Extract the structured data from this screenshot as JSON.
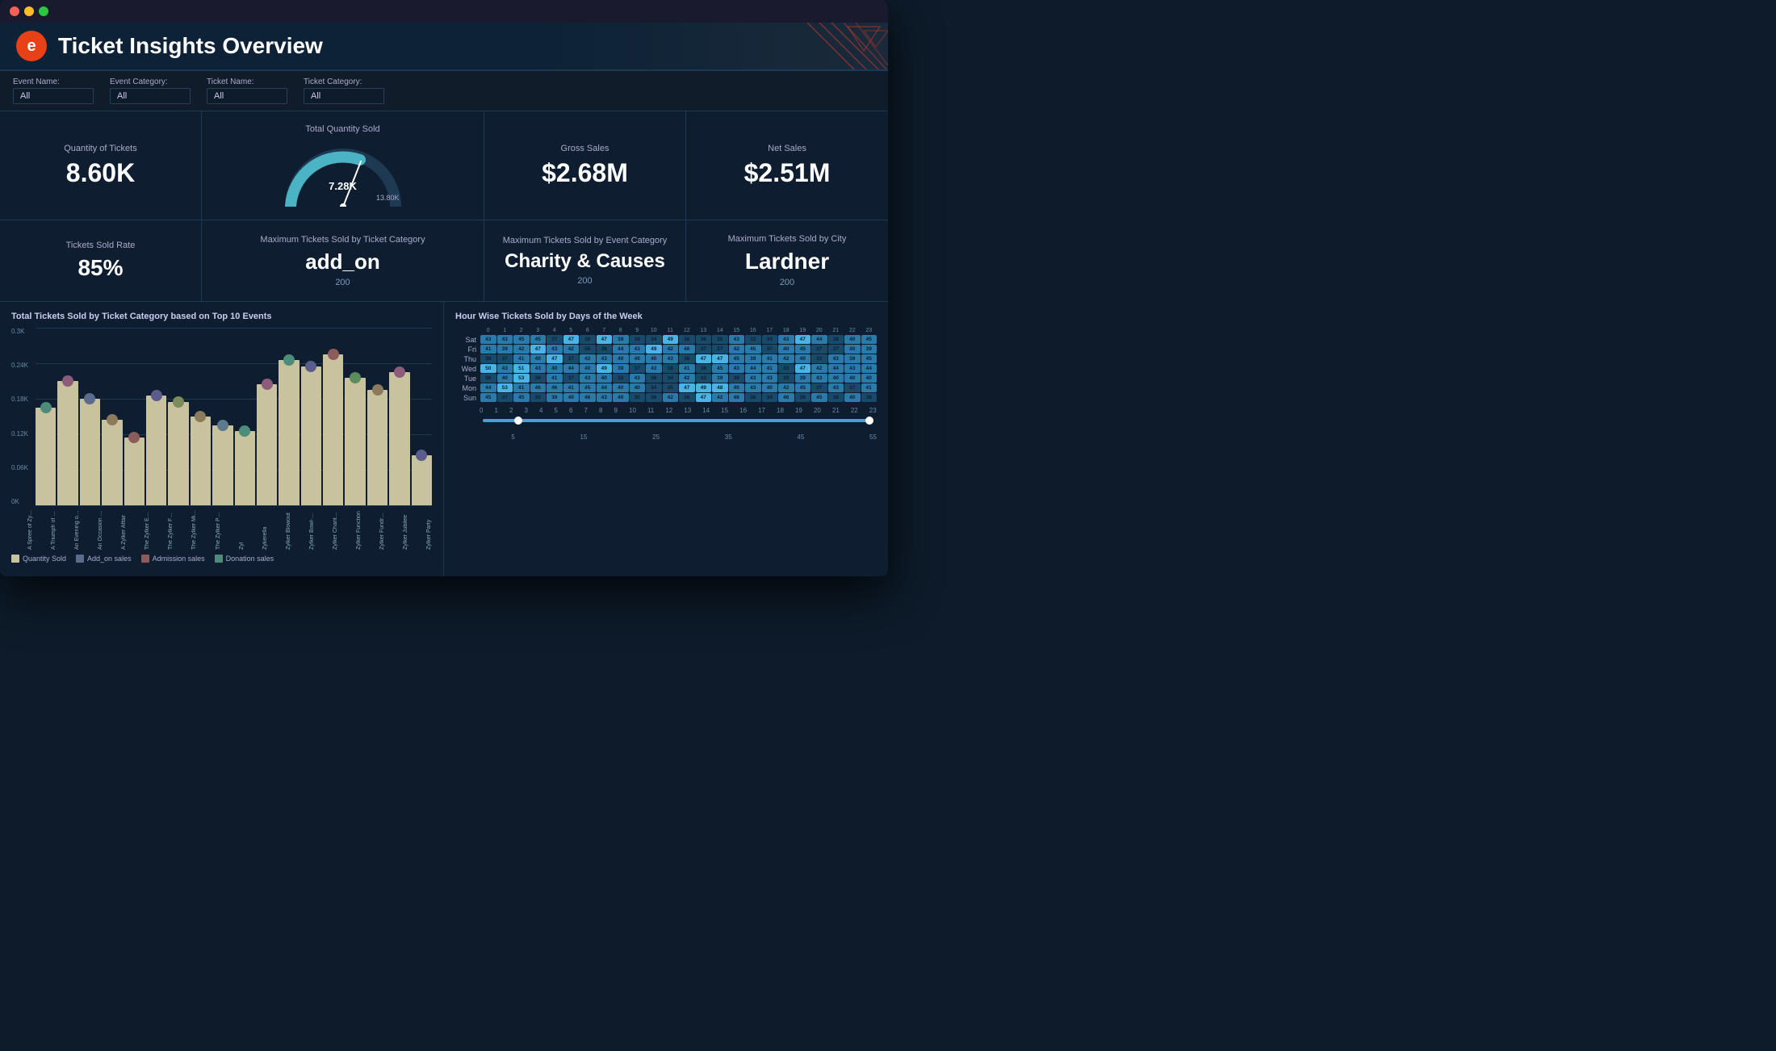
{
  "window": {
    "title": "Ticket Insights Overview"
  },
  "header": {
    "logo_letter": "e",
    "title": "Ticket Insights Overview"
  },
  "filters": [
    {
      "label": "Event Name:",
      "value": "All",
      "options": [
        "All"
      ]
    },
    {
      "label": "Event Category:",
      "value": "All",
      "options": [
        "All"
      ]
    },
    {
      "label": "Ticket Name:",
      "value": "All",
      "options": [
        "All"
      ]
    },
    {
      "label": "Ticket Category:",
      "value": "All",
      "options": [
        "All"
      ]
    }
  ],
  "kpi_row1": {
    "quantity": {
      "label": "Quantity of Tickets",
      "value": "8.60K"
    },
    "gauge": {
      "label": "Total Quantity Sold",
      "center_value": "7.28K",
      "max_value": "13.80K",
      "fill_pct": 53
    },
    "gross_sales": {
      "label": "Gross Sales",
      "value": "$2.68M"
    },
    "net_sales": {
      "label": "Net Sales",
      "value": "$2.51M"
    }
  },
  "kpi_row2": {
    "sold_rate": {
      "label": "Tickets Sold Rate",
      "value": "85%"
    },
    "max_ticket_cat": {
      "label": "Maximum Tickets Sold by Ticket Category",
      "value": "add_on",
      "sub": "200"
    },
    "max_event_cat": {
      "label": "Maximum Tickets Sold by Event Category",
      "value": "Charity & Causes",
      "sub": "200"
    },
    "max_city": {
      "label": "Maximum Tickets Sold by City",
      "value": "Lardner",
      "sub": "200"
    }
  },
  "bar_chart": {
    "title": "Total Tickets Sold by Ticket Category based on Top 10 Events",
    "y_labels": [
      "0.3K",
      "0.24K",
      "0.18K",
      "0.12K",
      "0.06K",
      "0K"
    ],
    "bars": [
      {
        "label": "A Spree of Zylker",
        "height_pct": 55,
        "dot_color": "#4d8c7b"
      },
      {
        "label": "A Triumph of Zylker",
        "height_pct": 70,
        "dot_color": "#8c5c7a"
      },
      {
        "label": "An Evening of Zylker",
        "height_pct": 60,
        "dot_color": "#5c6a8c"
      },
      {
        "label": "An Occasion for Zyl.",
        "height_pct": 48,
        "dot_color": "#8c7a5c"
      },
      {
        "label": "A Zylker Affair",
        "height_pct": 38,
        "dot_color": "#8c5c5c"
      },
      {
        "label": "The Zylker Event or.",
        "height_pct": 62,
        "dot_color": "#5c5c8c"
      },
      {
        "label": "The Zylker Function",
        "height_pct": 58,
        "dot_color": "#7a8c5c"
      },
      {
        "label": "The Zylker Miracle",
        "height_pct": 50,
        "dot_color": "#8c7a5c"
      },
      {
        "label": "The Zylker Perform.",
        "height_pct": 45,
        "dot_color": "#5c7a8c"
      },
      {
        "label": "Zyl",
        "height_pct": 42,
        "dot_color": "#4d8c7b"
      },
      {
        "label": "Zykerella",
        "height_pct": 68,
        "dot_color": "#8c5c7a"
      },
      {
        "label": "Zylker Blowout",
        "height_pct": 82,
        "dot_color": "#4d8c7b"
      },
      {
        "label": "Zylker Bowl-A-Thon",
        "height_pct": 78,
        "dot_color": "#5c5c8c"
      },
      {
        "label": "Zylker Charity Fund.",
        "height_pct": 85,
        "dot_color": "#8c5c5c"
      },
      {
        "label": "Zylker Function",
        "height_pct": 72,
        "dot_color": "#5c8c5c"
      },
      {
        "label": "Zylker Fundraiser",
        "height_pct": 65,
        "dot_color": "#8c7a5c"
      },
      {
        "label": "Zylker Jubilee",
        "height_pct": 75,
        "dot_color": "#8c5c7a"
      },
      {
        "label": "Zylker Party",
        "height_pct": 28,
        "dot_color": "#5c5c8c"
      }
    ],
    "legend": [
      {
        "label": "Quantity Sold",
        "color": "#c8c29e"
      },
      {
        "label": "Add_on sales",
        "color": "#5c6a8c"
      },
      {
        "label": "Admission sales",
        "color": "#8c5c5c"
      },
      {
        "label": "Donation sales",
        "color": "#4d8c7b"
      }
    ]
  },
  "heatmap": {
    "title": "Hour Wise Tickets Sold by Days of the Week",
    "days": [
      "Sat",
      "Fri",
      "Thu",
      "Wed",
      "Tue",
      "Mon",
      "Sun"
    ],
    "hours": [
      0,
      1,
      2,
      3,
      4,
      5,
      6,
      7,
      8,
      9,
      10,
      11,
      12,
      13,
      14,
      15,
      16,
      17,
      18,
      19,
      20,
      21,
      22,
      23
    ],
    "data": {
      "Sat": [
        43,
        43,
        45,
        45,
        37,
        47,
        38,
        47,
        39,
        38,
        34,
        49,
        38,
        36,
        35,
        43,
        32,
        34,
        43,
        47,
        44,
        38,
        40,
        45
      ],
      "Fri": [
        41,
        39,
        42,
        47,
        43,
        42,
        38,
        38,
        44,
        43,
        49,
        42,
        46,
        37,
        37,
        42,
        45,
        37,
        40,
        45,
        37,
        37,
        40,
        39
      ],
      "Thu": [
        38,
        37,
        41,
        40,
        47,
        37,
        42,
        43,
        40,
        46,
        40,
        43,
        38,
        47,
        47,
        45,
        39,
        41,
        42,
        40,
        33,
        43,
        39,
        45
      ],
      "Wed": [
        50,
        43,
        51,
        43,
        40,
        44,
        40,
        49,
        39,
        37,
        43,
        38,
        41,
        38,
        45,
        43,
        44,
        41,
        33,
        47,
        42,
        44,
        43,
        44
      ],
      "Tue": [
        36,
        40,
        53,
        36,
        41,
        37,
        43,
        40,
        32,
        43,
        36,
        34,
        42,
        33,
        39,
        38,
        43,
        43,
        35,
        39,
        43,
        40,
        40,
        40
      ],
      "Mon": [
        44,
        53,
        41,
        46,
        46,
        41,
        45,
        44,
        40,
        40,
        34,
        35,
        47,
        49,
        48,
        40,
        43,
        40,
        42,
        45,
        37,
        43,
        37,
        41
      ],
      "Sun": [
        45,
        37,
        45,
        35,
        39,
        40,
        46,
        43,
        40,
        30,
        36,
        42,
        36,
        47,
        42,
        46,
        36,
        34,
        46,
        38,
        45,
        38,
        40,
        38
      ]
    },
    "slider": {
      "min": 0,
      "max": 55,
      "start": 5,
      "end": 55,
      "labels": [
        "5",
        "15",
        "25",
        "35",
        "45",
        "55"
      ]
    }
  },
  "colors": {
    "bg_dark": "#0d1b2a",
    "bg_card": "#0e1e30",
    "accent_teal": "#4a9fd4",
    "accent_red": "#e84118",
    "border": "#1e3a52",
    "heatmap_low": "#1a4a6a",
    "heatmap_mid": "#2a7aaa",
    "heatmap_high": "#4ab4e4"
  }
}
